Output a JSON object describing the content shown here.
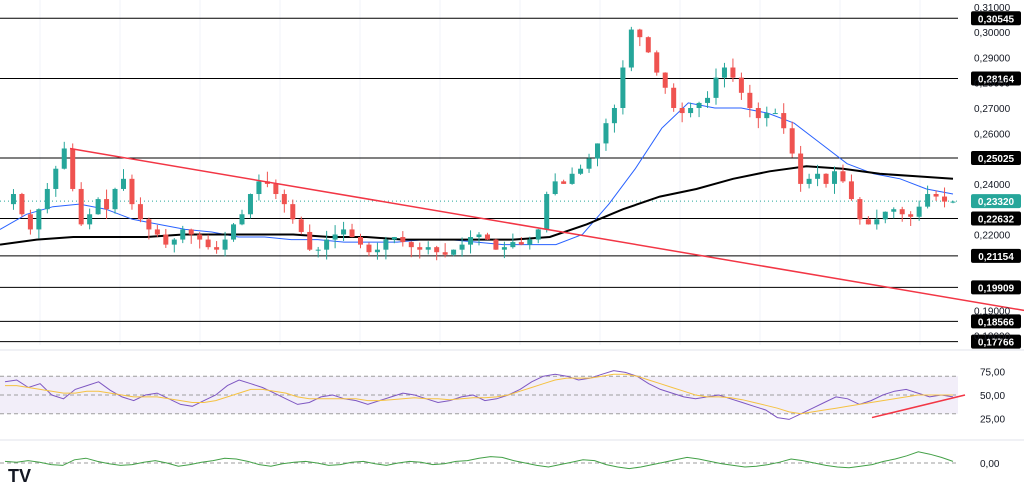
{
  "chart_data": [
    {
      "type": "candlestick",
      "panel": "price",
      "title": "",
      "ylim": [
        0.17766,
        0.31
      ],
      "y_ticks": [
        "0,31000",
        "0,30000",
        "0,29000",
        "0,28000",
        "0,27000",
        "0,26000",
        "0,24000",
        "0,22000",
        "0,19000",
        "0,18000"
      ],
      "horizontal_levels": [
        {
          "value": 0.30545,
          "label": "0,30545"
        },
        {
          "value": 0.28164,
          "label": "0,28164"
        },
        {
          "value": 0.25025,
          "label": "0,25025"
        },
        {
          "value": 0.22632,
          "label": "0,22632"
        },
        {
          "value": 0.21154,
          "label": "0,21154"
        },
        {
          "value": 0.19909,
          "label": "0,19909"
        },
        {
          "value": 0.18566,
          "label": "0,18566"
        },
        {
          "value": 0.17766,
          "label": "0,17766"
        }
      ],
      "last_price": {
        "value": 0.2332,
        "label": "0,23320",
        "color": "#26a69a"
      },
      "price_path": [
        0.232,
        0.236,
        0.228,
        0.222,
        0.23,
        0.238,
        0.246,
        0.254,
        0.238,
        0.224,
        0.228,
        0.234,
        0.23,
        0.238,
        0.242,
        0.232,
        0.226,
        0.222,
        0.22,
        0.216,
        0.218,
        0.222,
        0.22,
        0.218,
        0.215,
        0.214,
        0.218,
        0.224,
        0.228,
        0.236,
        0.241,
        0.24,
        0.236,
        0.232,
        0.226,
        0.221,
        0.214,
        0.214,
        0.218,
        0.22,
        0.222,
        0.219,
        0.216,
        0.213,
        0.214,
        0.218,
        0.219,
        0.217,
        0.215,
        0.214,
        0.215,
        0.213,
        0.212,
        0.214,
        0.216,
        0.219,
        0.22,
        0.218,
        0.214,
        0.215,
        0.217,
        0.216,
        0.218,
        0.222,
        0.236,
        0.241,
        0.24,
        0.244,
        0.246,
        0.25,
        0.256,
        0.264,
        0.27,
        0.286,
        0.301,
        0.298,
        0.292,
        0.284,
        0.278,
        0.27,
        0.268,
        0.27,
        0.272,
        0.274,
        0.282,
        0.286,
        0.282,
        0.276,
        0.27,
        0.266,
        0.268,
        0.268,
        0.262,
        0.252,
        0.24,
        0.242,
        0.244,
        0.24,
        0.245,
        0.241,
        0.234,
        0.226,
        0.224,
        0.226,
        0.229,
        0.23,
        0.228,
        0.227,
        0.231,
        0.236,
        0.235,
        0.233,
        0.233
      ],
      "moving_averages": [
        {
          "name": "",
          "color": "#2962ff",
          "path": [
            0.222,
            0.228,
            0.231,
            0.232,
            0.23,
            0.226,
            0.224,
            0.222,
            0.221,
            0.219,
            0.219,
            0.218,
            0.218,
            0.217,
            0.217,
            0.217,
            0.218,
            0.218,
            0.217,
            0.216,
            0.216,
            0.216,
            0.22,
            0.232,
            0.246,
            0.262,
            0.272,
            0.27,
            0.27,
            0.268,
            0.264,
            0.256,
            0.248,
            0.244,
            0.242,
            0.238,
            0.236
          ]
        },
        {
          "name": "",
          "color": "#000000",
          "path": [
            0.216,
            0.218,
            0.219,
            0.219,
            0.219,
            0.22,
            0.22,
            0.22,
            0.22,
            0.219,
            0.219,
            0.218,
            0.218,
            0.218,
            0.218,
            0.219,
            0.224,
            0.23,
            0.235,
            0.238,
            0.242,
            0.245,
            0.247,
            0.246,
            0.244,
            0.243,
            0.242
          ]
        }
      ],
      "trendlines": [
        {
          "color": "#f23645",
          "from_price": 0.254,
          "to_price": 0.19
        }
      ]
    },
    {
      "type": "line",
      "panel": "rsi",
      "y_ticks": [
        "75,00",
        "50,00",
        "25,00"
      ],
      "band": [
        30,
        70
      ],
      "midline": 50,
      "series": [
        {
          "name": "",
          "color": "#7e57c2",
          "values": [
            64,
            66,
            58,
            62,
            50,
            46,
            56,
            60,
            64,
            55,
            48,
            44,
            50,
            52,
            46,
            40,
            38,
            44,
            50,
            60,
            66,
            62,
            58,
            52,
            46,
            40,
            42,
            48,
            50,
            46,
            44,
            40,
            44,
            48,
            52,
            50,
            46,
            42,
            44,
            48,
            50,
            44,
            46,
            50,
            56,
            64,
            70,
            72,
            70,
            66,
            68,
            72,
            76,
            74,
            70,
            62,
            56,
            52,
            48,
            46,
            48,
            50,
            46,
            42,
            38,
            34,
            26,
            24,
            30,
            36,
            42,
            48,
            46,
            40,
            44,
            50,
            54,
            56,
            52,
            48,
            50,
            48
          ]
        },
        {
          "name": "",
          "color": "#f5c242",
          "values": [
            60,
            60,
            58,
            56,
            54,
            52,
            52,
            54,
            54,
            52,
            50,
            48,
            48,
            48,
            46,
            44,
            42,
            42,
            44,
            48,
            52,
            56,
            56,
            54,
            52,
            48,
            46,
            46,
            46,
            46,
            46,
            44,
            44,
            45,
            46,
            47,
            46,
            46,
            45,
            46,
            47,
            47,
            48,
            50,
            54,
            58,
            62,
            66,
            68,
            68,
            68,
            70,
            72,
            72,
            70,
            66,
            62,
            58,
            54,
            50,
            48,
            48,
            47,
            45,
            42,
            39,
            36,
            32,
            30,
            32,
            34,
            36,
            38,
            40,
            42,
            44,
            46,
            48,
            50,
            50,
            50,
            50
          ]
        }
      ],
      "trendlines": [
        {
          "color": "#f23645",
          "from_value": 26,
          "to_value": 50
        }
      ]
    },
    {
      "type": "line",
      "panel": "oscillator",
      "y_ticks": [
        "0,00"
      ],
      "zero_line": 0,
      "series": [
        {
          "name": "",
          "color": "#43a047",
          "values": [
            0.2,
            0.1,
            0.3,
            0.1,
            -0.2,
            -0.3,
            0.4,
            0.6,
            0.2,
            -0.1,
            -0.3,
            -0.2,
            0.1,
            0.3,
            0.0,
            -0.4,
            -0.2,
            0.1,
            0.3,
            0.6,
            0.5,
            0.2,
            -0.2,
            -0.4,
            -0.1,
            0.1,
            0.2,
            0.0,
            -0.3,
            -0.2,
            0.1,
            0.2,
            -0.1,
            -0.3,
            0.0,
            0.2,
            0.1,
            -0.2,
            -0.1,
            0.2,
            0.3,
            0.6,
            0.8,
            0.7,
            0.3,
            0.0,
            -0.3,
            -0.5,
            -0.2,
            0.1,
            0.4,
            0.3,
            -0.2,
            -0.5,
            -0.7,
            -0.5,
            -0.2,
            0.1,
            0.4,
            0.7,
            0.5,
            0.2,
            -0.1,
            -0.3,
            -0.5,
            -0.4,
            -0.2,
            0.1,
            0.5,
            0.3,
            0.0,
            -0.3,
            -0.5,
            -0.6,
            -0.4,
            -0.2,
            0.2,
            0.5,
            0.9,
            1.4,
            1.1,
            0.7,
            0.2
          ]
        }
      ]
    }
  ],
  "logo": "TV",
  "colors": {
    "up": "#26a69a",
    "down": "#ef5350",
    "rsi_band": "#7e57c2",
    "rsi_fill": "#ede7f6"
  },
  "icons": {
    "logo": "tradingview-logo-icon"
  }
}
